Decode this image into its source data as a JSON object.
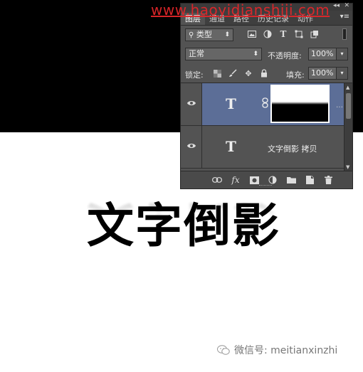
{
  "watermark": "www.haoyidianshiji.com",
  "canvas": {
    "main_text": "文字倒影",
    "wechat_label": "微信号: meitianxinzhi"
  },
  "panel": {
    "tabs": [
      {
        "label": "图层",
        "active": true
      },
      {
        "label": "通道",
        "active": false
      },
      {
        "label": "路径",
        "active": false
      },
      {
        "label": "历史记录",
        "active": false
      },
      {
        "label": "动作",
        "active": false
      }
    ],
    "filter": {
      "label": "类型",
      "search_icon": "search-icon",
      "icons": [
        "image-filter-icon",
        "adjustment-filter-icon",
        "type-filter-icon",
        "shape-filter-icon",
        "smart-object-filter-icon"
      ]
    },
    "blend_mode": "正常",
    "opacity_label": "不透明度:",
    "opacity_value": "100%",
    "lock_label": "锁定:",
    "fill_label": "填充:",
    "fill_value": "100%",
    "layers": [
      {
        "type_glyph": "T",
        "name": "",
        "selected": true,
        "has_mask": true
      },
      {
        "type_glyph": "T",
        "name": "文字倒影 拷贝",
        "selected": false,
        "has_mask": false
      }
    ],
    "bottom_icons": [
      "link-layers-icon",
      "fx-icon",
      "add-mask-icon",
      "adjustment-layer-icon",
      "group-folder-icon",
      "new-layer-icon",
      "trash-icon"
    ],
    "fx_label": "fx"
  },
  "colors": {
    "panel_bg": "#535353",
    "selected_layer": "#5c6e97",
    "watermark": "#e0262a"
  }
}
